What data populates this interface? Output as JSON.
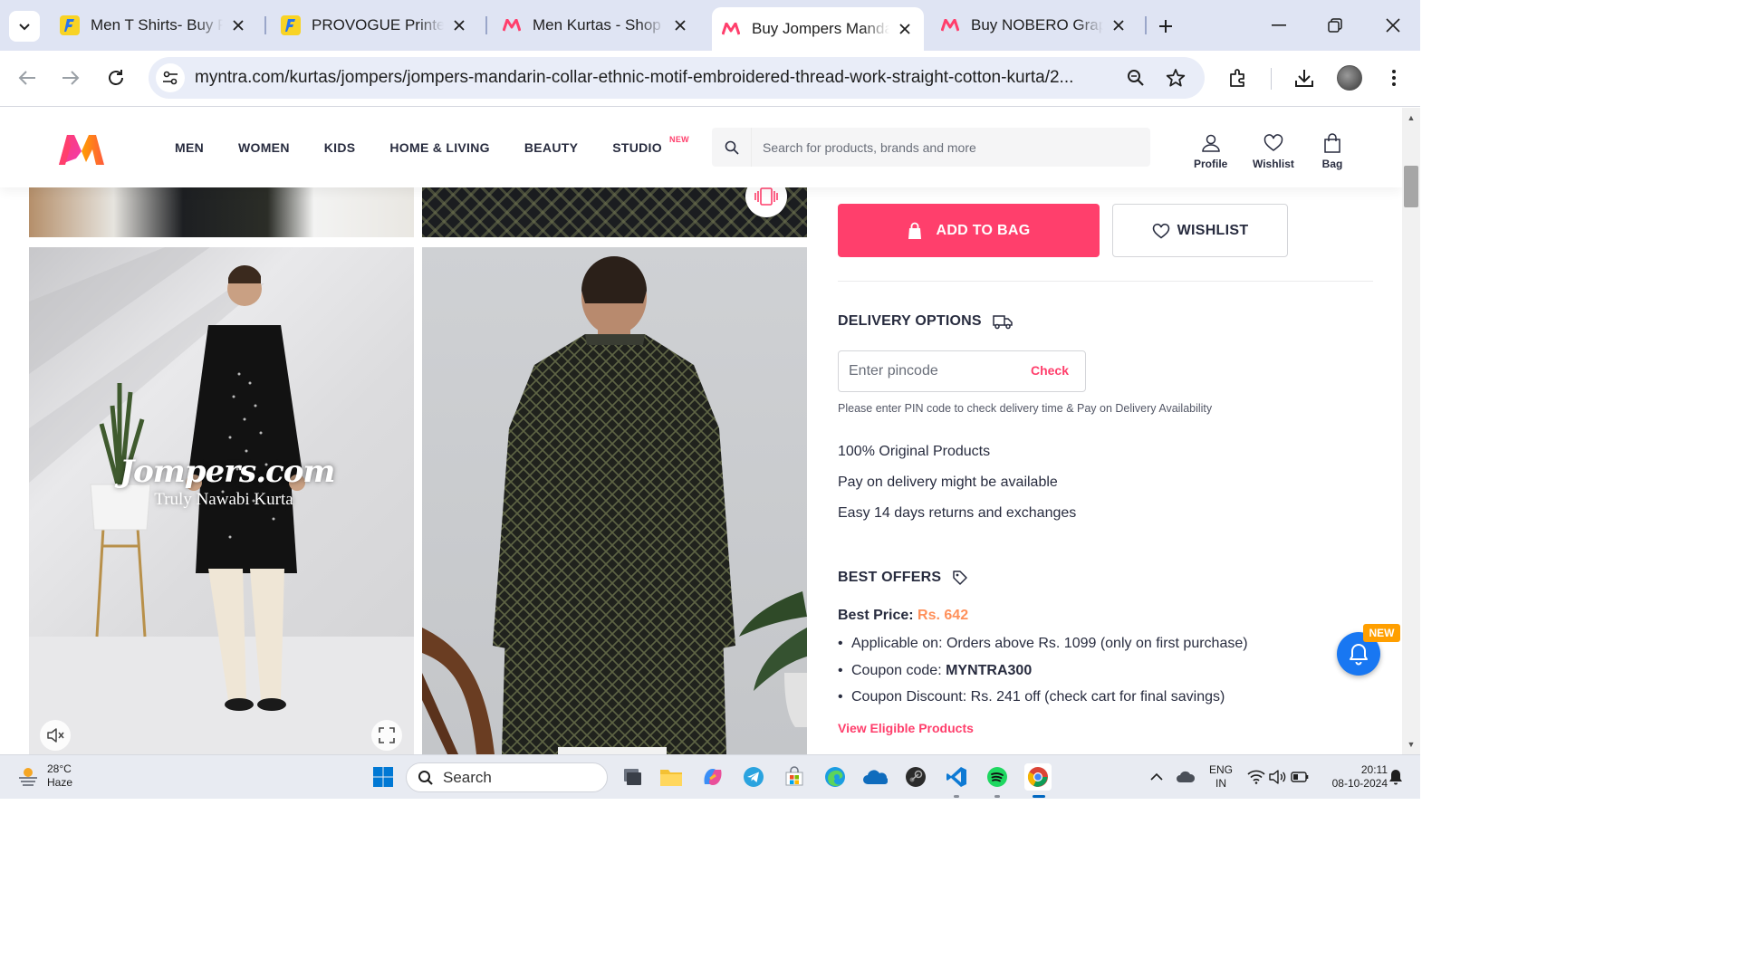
{
  "browser": {
    "tabs": [
      {
        "title": "Men T Shirts- Buy Products Online",
        "favicon": "flipkart-icon",
        "active": false
      },
      {
        "title": "PROVOGUE Printed Men Round Neck",
        "favicon": "flipkart-icon",
        "active": false
      },
      {
        "title": "Men Kurtas - Shop Online",
        "favicon": "myntra-icon",
        "active": false
      },
      {
        "title": "Buy Jompers Mandarin Collar",
        "favicon": "myntra-icon",
        "active": true
      },
      {
        "title": "Buy NOBERO Graphic Printed",
        "favicon": "myntra-icon",
        "active": false
      }
    ],
    "url": "myntra.com/kurtas/jompers/jompers-mandarin-collar-ethnic-motif-embroidered-thread-work-straight-cotton-kurta/2..."
  },
  "header": {
    "nav": [
      "MEN",
      "WOMEN",
      "KIDS",
      "HOME & LIVING",
      "BEAUTY",
      "STUDIO"
    ],
    "studio_badge": "NEW",
    "search_placeholder": "Search for products, brands and more",
    "actions": {
      "profile": "Profile",
      "wishlist": "Wishlist",
      "bag": "Bag"
    }
  },
  "gallery": {
    "watermark_brand": "Jompers.com",
    "watermark_tagline": "Truly Nawabi Kurta"
  },
  "product": {
    "add_to_bag": "ADD TO BAG",
    "wishlist": "WISHLIST",
    "delivery": {
      "title": "DELIVERY OPTIONS",
      "pincode_placeholder": "Enter pincode",
      "check": "Check",
      "note": "Please enter PIN code to check delivery time & Pay on Delivery Availability"
    },
    "assurances": [
      "100% Original Products",
      "Pay on delivery might be available",
      "Easy 14 days returns and exchanges"
    ],
    "offers": {
      "title": "BEST OFFERS",
      "best_price_label": "Best Price:",
      "best_price_value": "Rs. 642",
      "applicable": "Applicable on: Orders above Rs. 1099 (only on first purchase)",
      "coupon_label": "Coupon code:",
      "coupon_code": "MYNTRA300",
      "discount": "Coupon Discount: Rs. 241 off (check cart for final savings)",
      "view_link": "View Eligible Products"
    },
    "notif_badge": "NEW"
  },
  "taskbar": {
    "weather_temp": "28°C",
    "weather_desc": "Haze",
    "search_label": "Search",
    "lang_top": "ENG",
    "lang_bottom": "IN",
    "time": "20:11",
    "date": "08-10-2024"
  },
  "colors": {
    "accent": "#ff3f6c",
    "price_orange": "#ff905a",
    "tab_bar": "#dfe4f3",
    "bell_blue": "#1877f2"
  }
}
